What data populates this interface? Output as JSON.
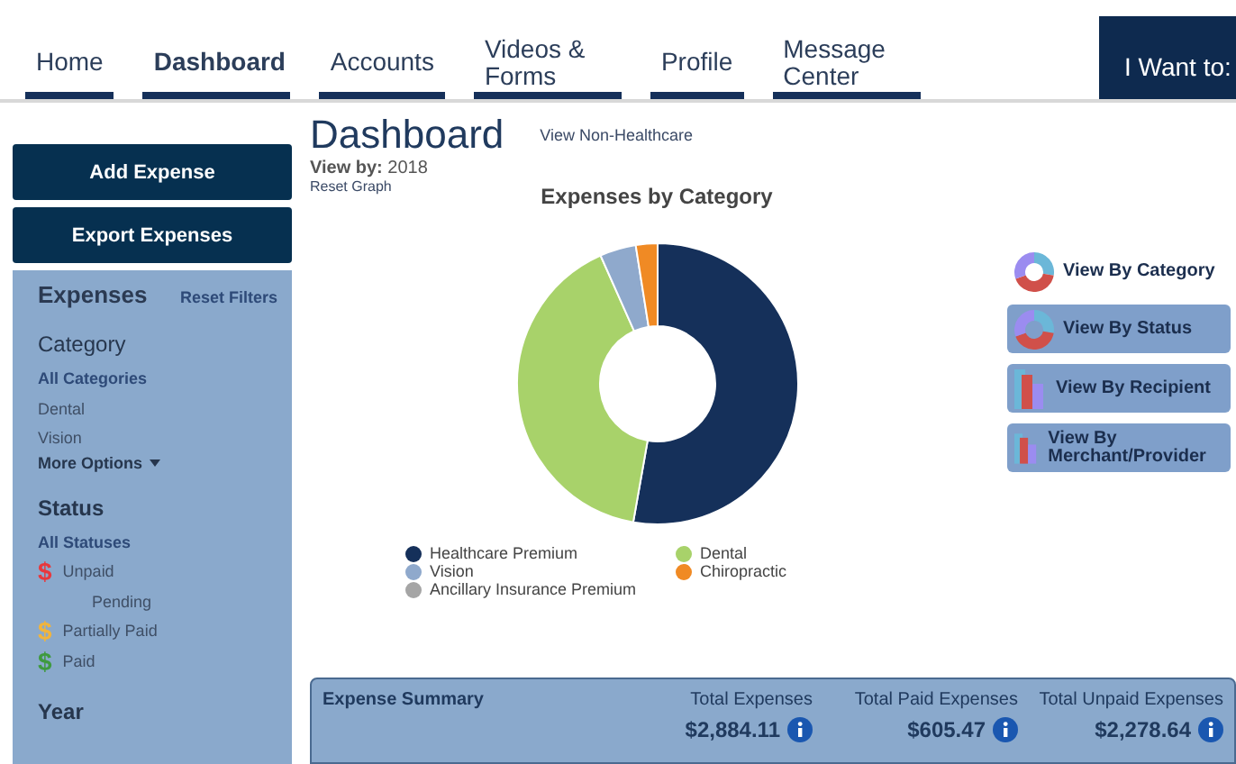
{
  "nav": {
    "tabs": [
      {
        "label": "Home",
        "selected": false
      },
      {
        "label": "Dashboard",
        "selected": true
      },
      {
        "label": "Accounts",
        "selected": false
      },
      {
        "label": "Videos & Forms",
        "selected": false
      },
      {
        "label": "Profile",
        "selected": false
      },
      {
        "label": "Message Center",
        "selected": false
      }
    ],
    "menu_button": "I Want to:"
  },
  "sidebar": {
    "buttons": [
      "Add Expense",
      "Export Expenses"
    ],
    "title": "Expenses",
    "reset": "Reset Filters",
    "sections": [
      {
        "heading": "Category",
        "items": [
          {
            "label": "All Categories",
            "selected": true
          },
          {
            "label": "Dental",
            "selected": false
          },
          {
            "label": "Vision",
            "selected": false
          }
        ],
        "more": "More Options"
      },
      {
        "heading": "Status",
        "items": [
          {
            "label": "All Statuses",
            "selected": true
          },
          {
            "label": "Unpaid",
            "selected": false,
            "color": "#e8383d",
            "icon": "$"
          },
          {
            "label": "Pending",
            "selected": false
          },
          {
            "label": "Partially Paid",
            "selected": false,
            "color": "#f2b43c",
            "icon": "$"
          },
          {
            "label": "Paid",
            "selected": false,
            "color": "#3f9a3f",
            "icon": "$"
          }
        ]
      },
      {
        "heading": "Year"
      }
    ]
  },
  "main": {
    "title": "Dashboard",
    "alt_link": "View Non-Healthcare",
    "view_by_label": "View by:",
    "view_by_value": "2018",
    "reset_graph": "Reset Graph",
    "chart_title": "Expenses by Category",
    "legend": [
      {
        "label": "Healthcare Premium",
        "color": "#15305a"
      },
      {
        "label": "Dental",
        "color": "#a8d26a"
      },
      {
        "label": "Vision",
        "color": "#8fa9cc"
      },
      {
        "label": "Chiropractic",
        "color": "#f08a24"
      },
      {
        "label": "Ancillary Insurance Premium",
        "color": "#a5a5a5"
      }
    ],
    "views": [
      {
        "label": "View By Category",
        "selected": true,
        "kind": "donut"
      },
      {
        "label": "View By Status",
        "selected": false,
        "kind": "donut"
      },
      {
        "label": "View By Recipient",
        "selected": false,
        "kind": "bar"
      },
      {
        "label": "View By Merchant/Provider",
        "selected": false,
        "kind": "bar"
      }
    ],
    "summary": {
      "title": "Expense Summary",
      "totals": [
        {
          "label": "Total Expenses",
          "value": "$2,884.11"
        },
        {
          "label": "Total Paid Expenses",
          "value": "$605.47"
        },
        {
          "label": "Total Unpaid Expenses",
          "value": "$2,278.64"
        }
      ]
    }
  }
}
